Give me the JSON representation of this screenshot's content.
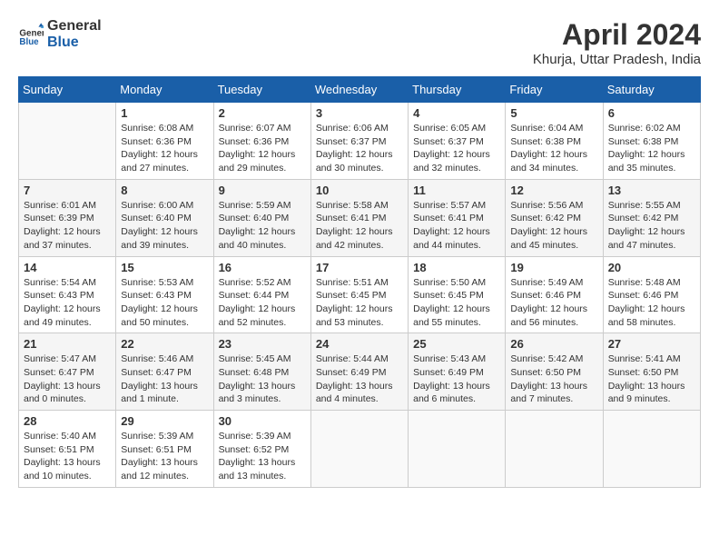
{
  "header": {
    "logo_line1": "General",
    "logo_line2": "Blue",
    "month_year": "April 2024",
    "location": "Khurja, Uttar Pradesh, India"
  },
  "weekdays": [
    "Sunday",
    "Monday",
    "Tuesday",
    "Wednesday",
    "Thursday",
    "Friday",
    "Saturday"
  ],
  "weeks": [
    [
      {
        "day": "",
        "info": ""
      },
      {
        "day": "1",
        "info": "Sunrise: 6:08 AM\nSunset: 6:36 PM\nDaylight: 12 hours\nand 27 minutes."
      },
      {
        "day": "2",
        "info": "Sunrise: 6:07 AM\nSunset: 6:36 PM\nDaylight: 12 hours\nand 29 minutes."
      },
      {
        "day": "3",
        "info": "Sunrise: 6:06 AM\nSunset: 6:37 PM\nDaylight: 12 hours\nand 30 minutes."
      },
      {
        "day": "4",
        "info": "Sunrise: 6:05 AM\nSunset: 6:37 PM\nDaylight: 12 hours\nand 32 minutes."
      },
      {
        "day": "5",
        "info": "Sunrise: 6:04 AM\nSunset: 6:38 PM\nDaylight: 12 hours\nand 34 minutes."
      },
      {
        "day": "6",
        "info": "Sunrise: 6:02 AM\nSunset: 6:38 PM\nDaylight: 12 hours\nand 35 minutes."
      }
    ],
    [
      {
        "day": "7",
        "info": "Sunrise: 6:01 AM\nSunset: 6:39 PM\nDaylight: 12 hours\nand 37 minutes."
      },
      {
        "day": "8",
        "info": "Sunrise: 6:00 AM\nSunset: 6:40 PM\nDaylight: 12 hours\nand 39 minutes."
      },
      {
        "day": "9",
        "info": "Sunrise: 5:59 AM\nSunset: 6:40 PM\nDaylight: 12 hours\nand 40 minutes."
      },
      {
        "day": "10",
        "info": "Sunrise: 5:58 AM\nSunset: 6:41 PM\nDaylight: 12 hours\nand 42 minutes."
      },
      {
        "day": "11",
        "info": "Sunrise: 5:57 AM\nSunset: 6:41 PM\nDaylight: 12 hours\nand 44 minutes."
      },
      {
        "day": "12",
        "info": "Sunrise: 5:56 AM\nSunset: 6:42 PM\nDaylight: 12 hours\nand 45 minutes."
      },
      {
        "day": "13",
        "info": "Sunrise: 5:55 AM\nSunset: 6:42 PM\nDaylight: 12 hours\nand 47 minutes."
      }
    ],
    [
      {
        "day": "14",
        "info": "Sunrise: 5:54 AM\nSunset: 6:43 PM\nDaylight: 12 hours\nand 49 minutes."
      },
      {
        "day": "15",
        "info": "Sunrise: 5:53 AM\nSunset: 6:43 PM\nDaylight: 12 hours\nand 50 minutes."
      },
      {
        "day": "16",
        "info": "Sunrise: 5:52 AM\nSunset: 6:44 PM\nDaylight: 12 hours\nand 52 minutes."
      },
      {
        "day": "17",
        "info": "Sunrise: 5:51 AM\nSunset: 6:45 PM\nDaylight: 12 hours\nand 53 minutes."
      },
      {
        "day": "18",
        "info": "Sunrise: 5:50 AM\nSunset: 6:45 PM\nDaylight: 12 hours\nand 55 minutes."
      },
      {
        "day": "19",
        "info": "Sunrise: 5:49 AM\nSunset: 6:46 PM\nDaylight: 12 hours\nand 56 minutes."
      },
      {
        "day": "20",
        "info": "Sunrise: 5:48 AM\nSunset: 6:46 PM\nDaylight: 12 hours\nand 58 minutes."
      }
    ],
    [
      {
        "day": "21",
        "info": "Sunrise: 5:47 AM\nSunset: 6:47 PM\nDaylight: 13 hours\nand 0 minutes."
      },
      {
        "day": "22",
        "info": "Sunrise: 5:46 AM\nSunset: 6:47 PM\nDaylight: 13 hours\nand 1 minute."
      },
      {
        "day": "23",
        "info": "Sunrise: 5:45 AM\nSunset: 6:48 PM\nDaylight: 13 hours\nand 3 minutes."
      },
      {
        "day": "24",
        "info": "Sunrise: 5:44 AM\nSunset: 6:49 PM\nDaylight: 13 hours\nand 4 minutes."
      },
      {
        "day": "25",
        "info": "Sunrise: 5:43 AM\nSunset: 6:49 PM\nDaylight: 13 hours\nand 6 minutes."
      },
      {
        "day": "26",
        "info": "Sunrise: 5:42 AM\nSunset: 6:50 PM\nDaylight: 13 hours\nand 7 minutes."
      },
      {
        "day": "27",
        "info": "Sunrise: 5:41 AM\nSunset: 6:50 PM\nDaylight: 13 hours\nand 9 minutes."
      }
    ],
    [
      {
        "day": "28",
        "info": "Sunrise: 5:40 AM\nSunset: 6:51 PM\nDaylight: 13 hours\nand 10 minutes."
      },
      {
        "day": "29",
        "info": "Sunrise: 5:39 AM\nSunset: 6:51 PM\nDaylight: 13 hours\nand 12 minutes."
      },
      {
        "day": "30",
        "info": "Sunrise: 5:39 AM\nSunset: 6:52 PM\nDaylight: 13 hours\nand 13 minutes."
      },
      {
        "day": "",
        "info": ""
      },
      {
        "day": "",
        "info": ""
      },
      {
        "day": "",
        "info": ""
      },
      {
        "day": "",
        "info": ""
      }
    ]
  ]
}
